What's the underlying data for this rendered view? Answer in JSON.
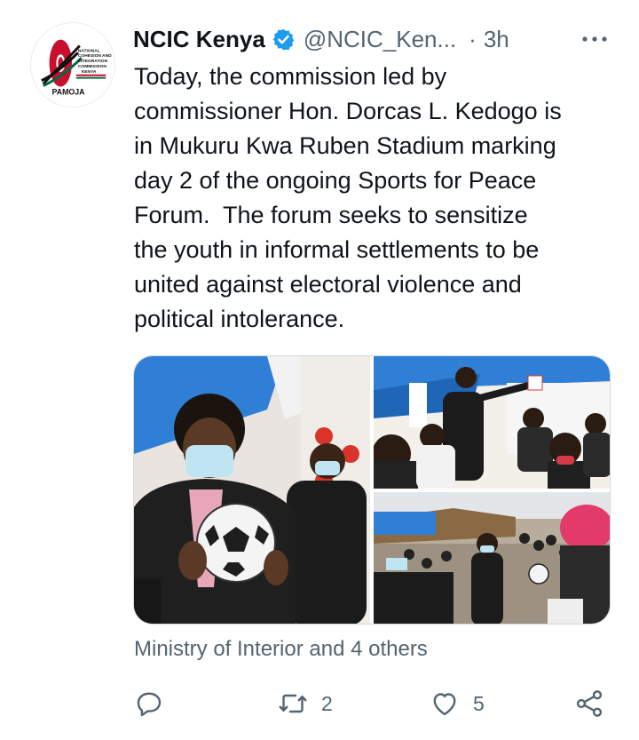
{
  "tweet": {
    "author_name": "NCIC Kenya",
    "author_handle": "@NCIC_Ken...",
    "separator": "·",
    "time": "3h",
    "verified": true,
    "text": "Today, the commission led by\ncommissioner Hon. Dorcas L. Kedogo is\nin Mukuru Kwa Ruben Stadium marking\nday 2 of the ongoing Sports for Peace\nForum.  The forum seeks to sensitize\nthe youth in informal settlements to be\nunited against electoral violence and\npolitical intolerance.",
    "tagged_text": "Ministry of Interior and 4 others",
    "logo_text": [
      "NATIONAL",
      "COHESION AND",
      "INTEGRATION",
      "COMMISSION",
      "KENYA",
      "PAMOJA"
    ]
  },
  "media": {
    "count": 3,
    "photos": [
      "commissioner-holding-ball-photo",
      "commissioner-speaking-tent-photo",
      "stadium-crowd-photo"
    ]
  },
  "actions": {
    "reply_icon": "reply-icon",
    "retweet_icon": "retweet-icon",
    "retweet_count": "2",
    "like_icon": "heart-icon",
    "like_count": "5",
    "share_icon": "share-icon"
  },
  "colors": {
    "verified_blue": "#1d9bf0",
    "secondary_text": "#536471",
    "primary_text": "#0f1419",
    "logo_red": "#c8102e",
    "logo_green": "#006b3f"
  }
}
